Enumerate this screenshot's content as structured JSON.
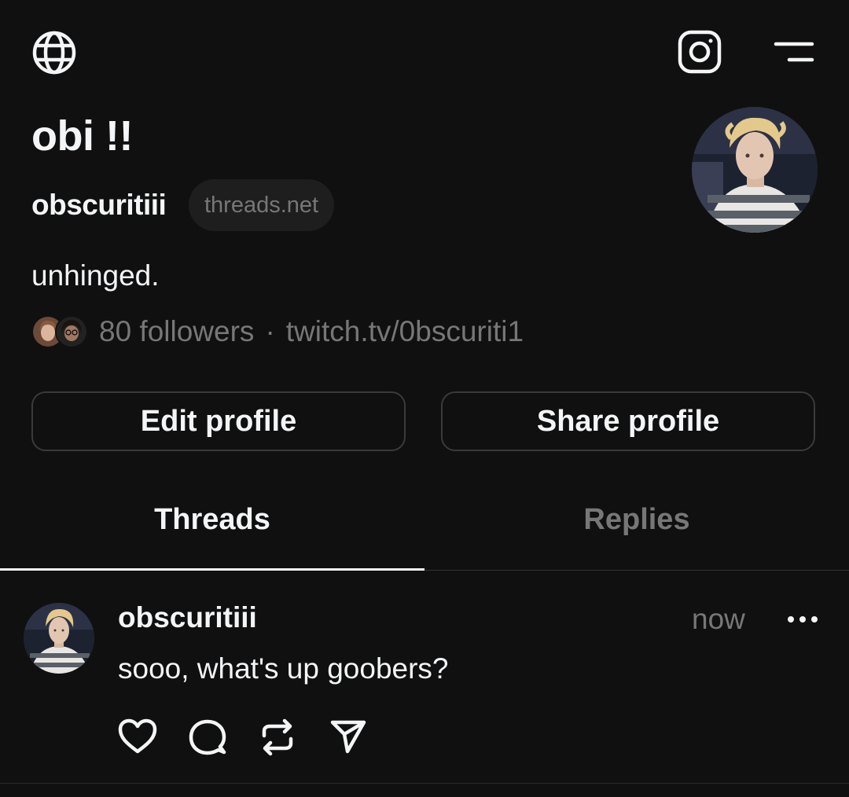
{
  "header": {
    "globe_icon": "globe-icon",
    "instagram_icon": "instagram-icon",
    "menu_icon": "menu-icon"
  },
  "profile": {
    "display_name": "obi !!",
    "username": "obscuritiii",
    "domain_badge": "threads.net",
    "bio": "unhinged.",
    "followers": "80 followers",
    "separator": "·",
    "link": "twitch.tv/0bscuriti1"
  },
  "buttons": {
    "edit": "Edit profile",
    "share": "Share profile"
  },
  "tabs": [
    {
      "label": "Threads",
      "active": true
    },
    {
      "label": "Replies",
      "active": false
    }
  ],
  "post": {
    "username": "obscuritiii",
    "time": "now",
    "text": "sooo, what's up goobers?",
    "actions": [
      "heart-icon",
      "comment-icon",
      "repost-icon",
      "send-icon"
    ]
  }
}
